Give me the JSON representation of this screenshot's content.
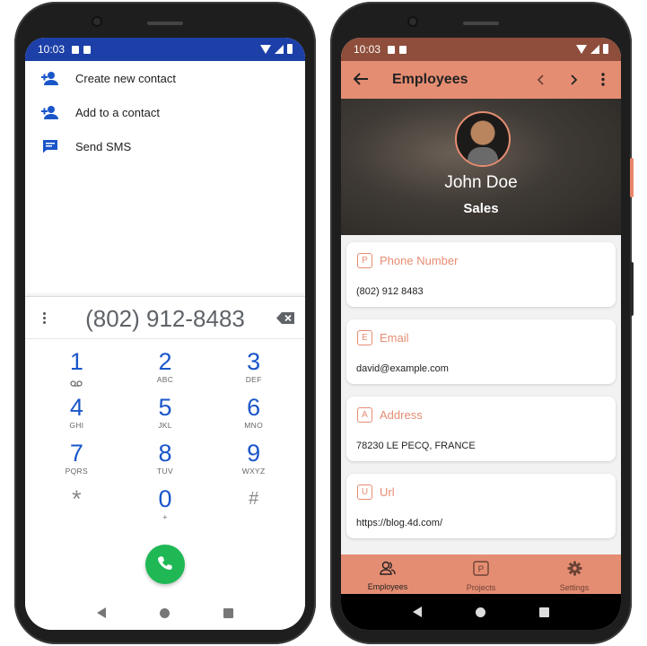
{
  "phone_dialer": {
    "status_time": "10:03",
    "menu": [
      {
        "label": "Create new contact",
        "icon": "person-add-icon"
      },
      {
        "label": "Add to a contact",
        "icon": "person-add-icon"
      },
      {
        "label": "Send SMS",
        "icon": "message-icon"
      }
    ],
    "dialed_number": "(802) 912-8483",
    "keys": [
      {
        "digit": "1",
        "letters": "voicemail"
      },
      {
        "digit": "2",
        "letters": "ABC"
      },
      {
        "digit": "3",
        "letters": "DEF"
      },
      {
        "digit": "4",
        "letters": "GHI"
      },
      {
        "digit": "5",
        "letters": "JKL"
      },
      {
        "digit": "6",
        "letters": "MNO"
      },
      {
        "digit": "7",
        "letters": "PQRS"
      },
      {
        "digit": "8",
        "letters": "TUV"
      },
      {
        "digit": "9",
        "letters": "WXYZ"
      },
      {
        "digit": "*",
        "letters": ""
      },
      {
        "digit": "0",
        "letters": "+"
      },
      {
        "digit": "#",
        "letters": ""
      }
    ],
    "colors": {
      "status_bar": "#1c3fa8",
      "digit": "#1a56c9",
      "call": "#1fb855"
    }
  },
  "phone_app": {
    "status_time": "10:03",
    "title": "Employees",
    "employee_name": "John Doe",
    "employee_dept": "Sales",
    "fields": [
      {
        "letter": "P",
        "label": "Phone Number",
        "value": "(802) 912 8483"
      },
      {
        "letter": "E",
        "label": "Email",
        "value": "david@example.com"
      },
      {
        "letter": "A",
        "label": "Address",
        "value": "78230 LE PECQ, FRANCE"
      },
      {
        "letter": "U",
        "label": "Url",
        "value": "https://blog.4d.com/"
      }
    ],
    "tabs": [
      {
        "label": "Employees",
        "icon": "people-icon"
      },
      {
        "label": "Projects",
        "icon": "projects-icon"
      },
      {
        "label": "Settings",
        "icon": "gear-icon"
      }
    ],
    "colors": {
      "accent": "#e58d72",
      "status_bar": "#8e4e3b"
    }
  }
}
